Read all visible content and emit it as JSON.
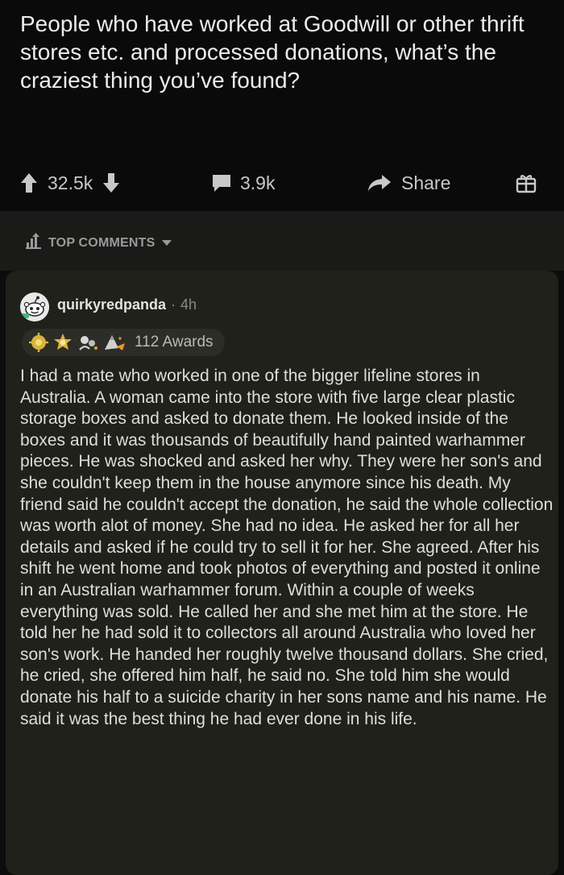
{
  "post": {
    "title": "People who have worked at Goodwill or other thrift stores etc. and processed donations, what’s the craziest thing you’ve found?",
    "upvotes": "32.5k",
    "comments": "3.9k",
    "share_label": "Share"
  },
  "sort": {
    "label": "TOP COMMENTS"
  },
  "comment": {
    "username": "quirkyredpanda",
    "separator": "·",
    "age": "4h",
    "awards_label": "112 Awards",
    "body": "I had a mate who worked in one of the bigger lifeline stores in Australia. A woman came into the store with five large clear plastic storage boxes and asked to donate them. He looked inside of the boxes and it was thousands of beautifully hand painted warhammer pieces. He was shocked and asked her why. They were her son's and she couldn't keep them in the house anymore since his death. My friend said he couldn't accept the donation, he said the whole collection was worth alot of money. She had no idea. He asked her for all her details and asked if he could try to sell it for her. She agreed. After his shift he went home and took photos of everything and posted it online in an Australian warhammer forum. Within a couple of weeks everything was sold. He called her and she met him at the store. He told her he had sold it to collectors all around Australia who loved her son's work. He handed her roughly twelve thousand dollars. She cried, he cried, she offered him half,  he said no. She told him she would donate his half to a suicide charity in her sons name and his name. He said it was the best thing he had ever done in his life."
  },
  "icons": {
    "upvote": "upvote-arrow-icon",
    "downvote": "downvote-arrow-icon",
    "comment": "comment-bubble-icon",
    "share": "share-arrow-icon",
    "gift": "gift-icon",
    "sort": "sort-bars-icon",
    "caret": "caret-down-icon",
    "avatar": "reddit-avatar-icon"
  },
  "colors": {
    "page_bg": "#0c0c0c",
    "card_bg": "#21211b",
    "text": "#dddddd",
    "muted": "#8a8a8a"
  }
}
